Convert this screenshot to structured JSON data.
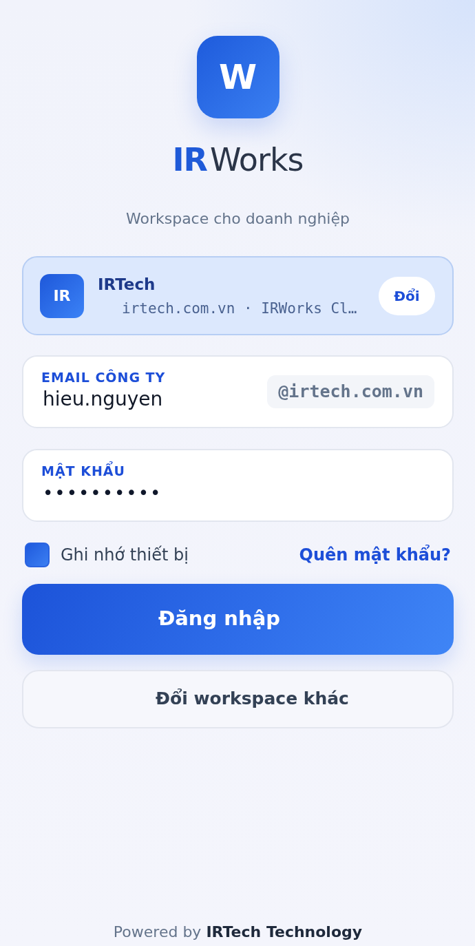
{
  "logo": {
    "letter": "W"
  },
  "brand": "**IR**Works",
  "tagline": "Workspace cho doanh nghiệp",
  "workspace": {
    "initials": "IR",
    "name": "IRTech",
    "detail": "irtech.com.vn · IRWorks Cl…",
    "change_button": "Đổi"
  },
  "email_field": {
    "label": "EMAIL CÔNG TY",
    "value": "hieu.nguyen",
    "suffix": "@irtech.com.vn"
  },
  "password_field": {
    "label": "MẬT KHẨU",
    "value": "••••••••••"
  },
  "remember": {
    "label": "Ghi nhớ thiết bị",
    "checked": true
  },
  "forgot_link": "Quên mật khẩu?",
  "buttons": [
    {
      "label": "Đăng nhập",
      "kind": "primary"
    },
    {
      "label": "Đổi workspace khác",
      "kind": "secondary"
    }
  ],
  "footer": "Powered by **IRTech Technology**"
}
